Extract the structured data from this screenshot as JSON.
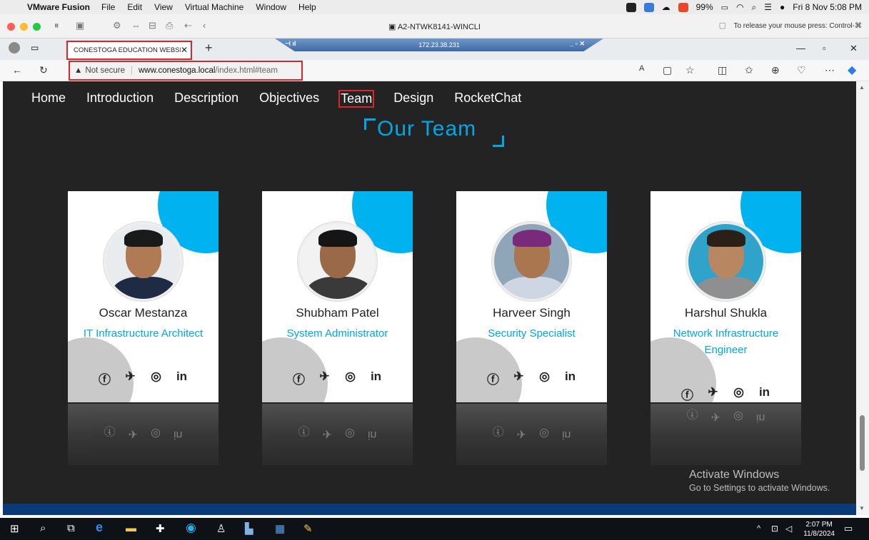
{
  "mac_menu": {
    "app": "VMware Fusion",
    "items": [
      "File",
      "Edit",
      "View",
      "Virtual Machine",
      "Window",
      "Help"
    ],
    "battery": "99%",
    "clock": "Fri 8 Nov  5:08 PM"
  },
  "vmware": {
    "title": "A2-NTWK8141-WINCLI",
    "release_hint": "To release your mouse press: Control-⌘"
  },
  "rdp": {
    "ip": "172.23.38.231"
  },
  "browser": {
    "tab_title": "CONESTOGA EDUCATION WEBSITE",
    "security": "Not secure",
    "url_host": "www.conestoga.local",
    "url_path": "/index.html#team"
  },
  "nav": {
    "items": [
      "Home",
      "Introduction",
      "Description",
      "Objectives",
      "Team",
      "Design",
      "RocketChat"
    ],
    "active": "Team"
  },
  "team": {
    "title": "Our Team",
    "members": [
      {
        "name": "Oscar Mestanza",
        "role": "IT Infrastructure Architect"
      },
      {
        "name": "Shubham Patel",
        "role": "System Administrator"
      },
      {
        "name": "Harveer Singh",
        "role": "Security Specialist"
      },
      {
        "name": "Harshul Shukla",
        "role": "Network Infrastructure Engineer"
      }
    ],
    "social": [
      "facebook-icon",
      "twitter-icon",
      "instagram-icon",
      "linkedin-icon"
    ]
  },
  "watermark": {
    "line1": "Activate Windows",
    "line2": "Go to Settings to activate Windows."
  },
  "taskbar": {
    "time": "2:07 PM",
    "date": "11/8/2024"
  },
  "colors": {
    "accent": "#00a8e8",
    "highlight": "#d9262b",
    "page_bg": "#232323"
  }
}
